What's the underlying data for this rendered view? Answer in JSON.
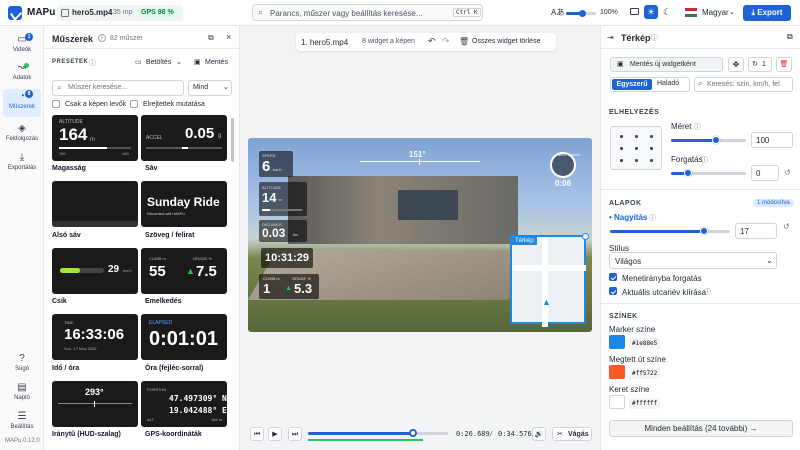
{
  "app": {
    "name": "MAPu",
    "version": "MAPu 0.12.0"
  },
  "topbar": {
    "file_name": "hero5.mp4",
    "fps": "35 mp",
    "gps_badge": "GPS 98 %",
    "search_placeholder": "Parancs, műszer vagy beállítás keresése...",
    "shortcut": "Ctrl K",
    "zoom": "100%",
    "language": "Magyar",
    "export_label": "Export"
  },
  "rail": {
    "items": [
      {
        "label": "Videók",
        "icon": "video-icon",
        "badge": "1"
      },
      {
        "label": "Adatok",
        "icon": "data-icon"
      },
      {
        "label": "Műszerek",
        "icon": "gauge-icon",
        "badge": "8"
      },
      {
        "label": "Feldolgozás",
        "icon": "layers-icon"
      },
      {
        "label": "Exportálás",
        "icon": "download-icon"
      }
    ],
    "bottom": [
      {
        "label": "Súgó",
        "icon": "help-icon"
      },
      {
        "label": "Napló",
        "icon": "log-icon"
      },
      {
        "label": "Beállítás",
        "icon": "settings-icon"
      }
    ]
  },
  "widgets_panel": {
    "title": "Műszerek",
    "count": "82 műszer",
    "presets_label": "PRESETEK",
    "load_label": "Betöltés",
    "save_label": "Mentés",
    "search_placeholder": "Műszer keresése...",
    "filter": "Mind",
    "check1": "Csak a képen levők",
    "check2": "Elrejtettek mutatása",
    "cards": [
      {
        "name": "Magasság",
        "line1": "ALTITUDE",
        "big": "164",
        "unit": "m",
        "sub1": "180",
        "sub2": "180"
      },
      {
        "name": "Sáv",
        "line1": "ACCEL",
        "big": "0.05",
        "unit": "g"
      },
      {
        "name": "Alsó sáv"
      },
      {
        "name": "Szöveg / felirat",
        "big": "Sunday Ride",
        "sub1": "Recorded with MAPu"
      },
      {
        "name": "Csík",
        "big": "29",
        "unit": "km/h"
      },
      {
        "name": "Emelkedés",
        "line1": "CLIMB m",
        "line2": "GRADE %",
        "big": "55",
        "big2": "7.5"
      },
      {
        "name": "Idő / óra",
        "line1": "TIME",
        "big": "16:33:06",
        "sub1": "Sun, 17 May 2026"
      },
      {
        "name": "Óra (fejléc-sorral)",
        "line1": "ELAPSED",
        "big": "0:01:01"
      },
      {
        "name": "Iránytű (HUD-szalag)",
        "big": "293°"
      },
      {
        "name": "GPS-koordináták",
        "line1": "POSITION",
        "big": "47.497309° N",
        "big2": "19.042488° E",
        "sub1": "ALT",
        "sub2": "164 m"
      }
    ]
  },
  "canvas": {
    "tab": "1. hero5.mp4",
    "widget_count": "8 widget a képen",
    "clear_label": "Összes widget törlése",
    "overlay": {
      "speed_label": "SPEED",
      "speed": "6",
      "speed_unit": "km/h",
      "alt_label": "ALTITUDE",
      "alt": "14",
      "alt_unit": "m",
      "dist_label": "DISTANCE",
      "dist": "0.03",
      "dist_unit": "km",
      "clock": "10:31:29",
      "climb_label": "CLIMB m",
      "climb": "1",
      "grade_label": "GRADE %",
      "grade": "5.3",
      "heading": "151°",
      "max_label": "MAX 0 km/h",
      "gauge_value": "0:06",
      "map_label": "Térkép"
    }
  },
  "timeline": {
    "current": "0:26.689",
    "total": "0:34.576",
    "separator": "/",
    "progress": 0.75,
    "cut_label": "Vágás"
  },
  "right_panel": {
    "title": "Térkép",
    "save_widget": "Mentés új widgetként",
    "count": "1",
    "tab_simple": "Egyszerű",
    "tab_advanced": "Haladó",
    "search_placeholder": "Keresés: szín, km/h, fel",
    "section_layout": "ELHELYEZÉS",
    "size_label": "Méret",
    "size_value": "100",
    "size_level": 0.6,
    "rotate_label": "Forgatás",
    "rotate_value": "0",
    "rotate_level": 0.22,
    "section_basic": "ALAPOK",
    "modified": "1 módosítva",
    "zoom_label": "Nagyítás",
    "zoom_value": "17",
    "zoom_level": 0.78,
    "style_label": "Stílus",
    "style_value": "Világos",
    "check_rotate": "Menetirányba forgatás",
    "check_street": "Aktuális utcanév kiírása",
    "section_colors": "SZÍNEK",
    "marker_label": "Marker színe",
    "marker_color": "#1e88e5",
    "path_label": "Megtett út színe",
    "path_color": "#ff5722",
    "frame_label": "Keret színe",
    "frame_color": "#ffffff",
    "all_settings": "Minden beállítás (24 további)"
  },
  "colors": {
    "accent": "#1e63d6"
  }
}
